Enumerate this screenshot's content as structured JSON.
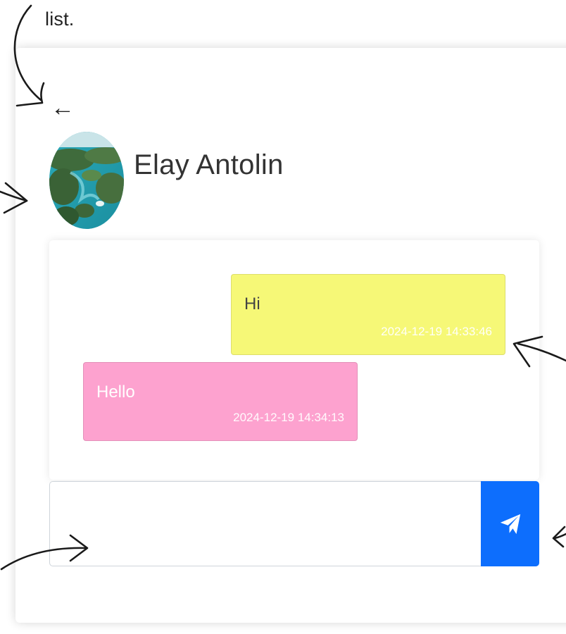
{
  "caption": {
    "text": "list."
  },
  "chat": {
    "back_icon": "arrow-left-icon",
    "contact_name": "Elay Antolin",
    "avatar": "contact-avatar-landscape"
  },
  "messages": [
    {
      "direction": "sent",
      "text": "Hi",
      "timestamp": "2024-12-19 14:33:46",
      "color": "#f6f877"
    },
    {
      "direction": "received",
      "text": "Hello",
      "timestamp": "2024-12-19 14:34:13",
      "color": "#fda2cf"
    }
  ],
  "composer": {
    "value": "",
    "send_icon": "paper-plane-icon",
    "send_color": "#0d6efd"
  }
}
